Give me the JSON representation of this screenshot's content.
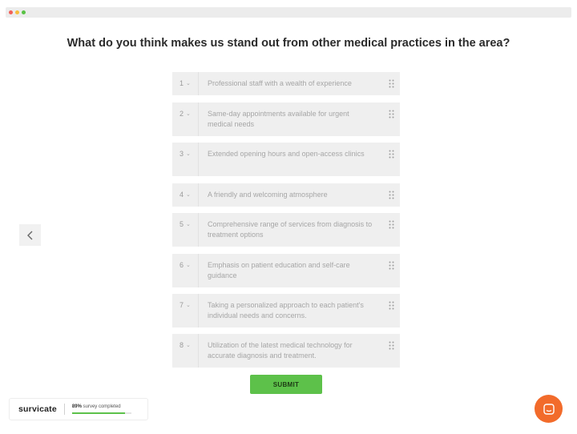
{
  "question": "What do you think makes us stand out from other medical practices in the area?",
  "items": [
    {
      "rank": "1",
      "text": "Professional staff with a wealth of experience"
    },
    {
      "rank": "2",
      "text": "Same-day appointments available for urgent medical needs"
    },
    {
      "rank": "3",
      "text": "Extended opening hours and open-access clinics"
    },
    {
      "rank": "4",
      "text": "A friendly and welcoming atmosphere"
    },
    {
      "rank": "5",
      "text": "Comprehensive range of services from diagnosis to treatment options"
    },
    {
      "rank": "6",
      "text": "Emphasis on patient education and self-care guidance"
    },
    {
      "rank": "7",
      "text": "Taking a personalized approach to each patient's individual needs and concerns."
    },
    {
      "rank": "8",
      "text": "Utilization of the latest medical technology for accurate diagnosis and treatment."
    }
  ],
  "submit_label": "SUBMIT",
  "footer": {
    "brand": "survicate",
    "progress_percent": "89%",
    "progress_label": "survey completed",
    "progress_value": 0.89
  },
  "colors": {
    "accent": "#5dc14a",
    "chat": "#f26b2b"
  },
  "icons": {
    "back": "chevron-left-icon",
    "drag": "drag-handle-icon",
    "chat": "chat-icon"
  }
}
